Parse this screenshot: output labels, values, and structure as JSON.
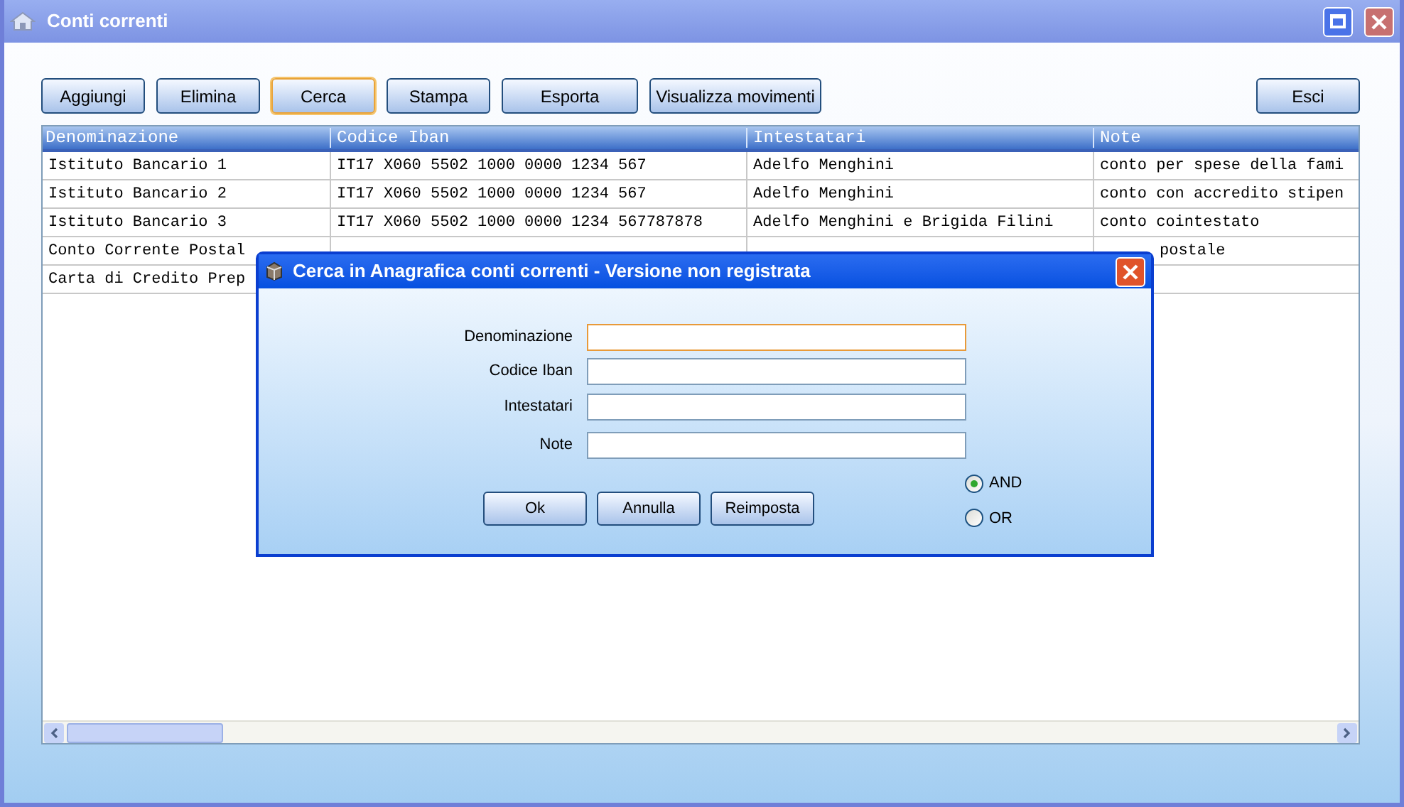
{
  "window": {
    "title": "Conti correnti"
  },
  "toolbar": [
    {
      "label": "Aggiungi",
      "focused": false
    },
    {
      "label": "Elimina",
      "focused": false
    },
    {
      "label": "Cerca",
      "focused": true
    },
    {
      "label": "Stampa",
      "focused": false
    },
    {
      "label": "Esporta",
      "focused": false
    },
    {
      "label": "Visualizza movimenti",
      "focused": false
    }
  ],
  "exit_button": "Esci",
  "table": {
    "columns": [
      "Denominazione",
      "Codice Iban",
      "Intestatari",
      "Note"
    ],
    "rows": [
      {
        "partly_hidden": false,
        "cells": [
          "Istituto Bancario 1",
          "IT17 X060 5502 1000 0000 1234 567",
          "Adelfo Menghini",
          "conto per spese della fami"
        ]
      },
      {
        "partly_hidden": false,
        "cells": [
          "Istituto Bancario 2",
          "IT17 X060 5502 1000 0000 1234 567",
          "Adelfo Menghini",
          "conto con accredito stipen"
        ]
      },
      {
        "partly_hidden": false,
        "cells": [
          "Istituto Bancario 3",
          "IT17 X060 5502 1000 0000 1234 567787878",
          "Adelfo Menghini e Brigida Filini",
          "conto cointestato"
        ]
      },
      {
        "partly_hidden": true,
        "cells": [
          "Conto Corrente Postal",
          null,
          null,
          "postale"
        ]
      },
      {
        "cells": [
          "Carta di Credito Prep",
          null,
          null,
          null
        ]
      }
    ]
  },
  "dialog": {
    "title": "Cerca in Anagrafica conti correnti - Versione non registrata",
    "fields": [
      {
        "label": "Denominazione",
        "focused": true
      },
      {
        "label": "Codice Iban",
        "focused": false
      },
      {
        "label": "Intestatari",
        "focused": false
      },
      {
        "label": "Note",
        "focused": false
      }
    ],
    "buttons": [
      "Ok",
      "Annulla",
      "Reimposta"
    ],
    "options": [
      {
        "label": "AND",
        "selected": true
      },
      {
        "label": "OR",
        "selected": false
      }
    ]
  }
}
